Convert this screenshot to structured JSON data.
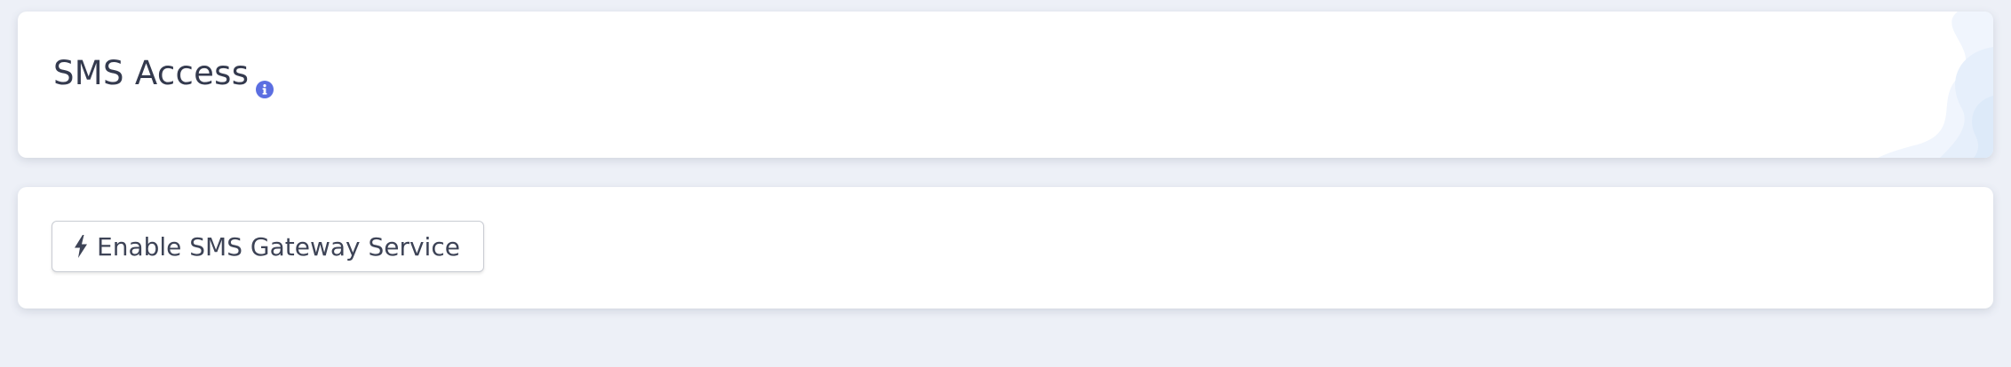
{
  "header": {
    "title": "SMS Access",
    "info_icon": "info-circle-icon"
  },
  "actions": {
    "enable_gateway_label": "Enable SMS Gateway Service",
    "enable_gateway_icon": "bolt-icon"
  },
  "colors": {
    "page_background": "#edf0f7",
    "card_background": "#ffffff",
    "title_text": "#343a4e",
    "info_icon": "#5b6ee1",
    "button_text": "#3d4356",
    "button_border": "#c9ccd3"
  }
}
